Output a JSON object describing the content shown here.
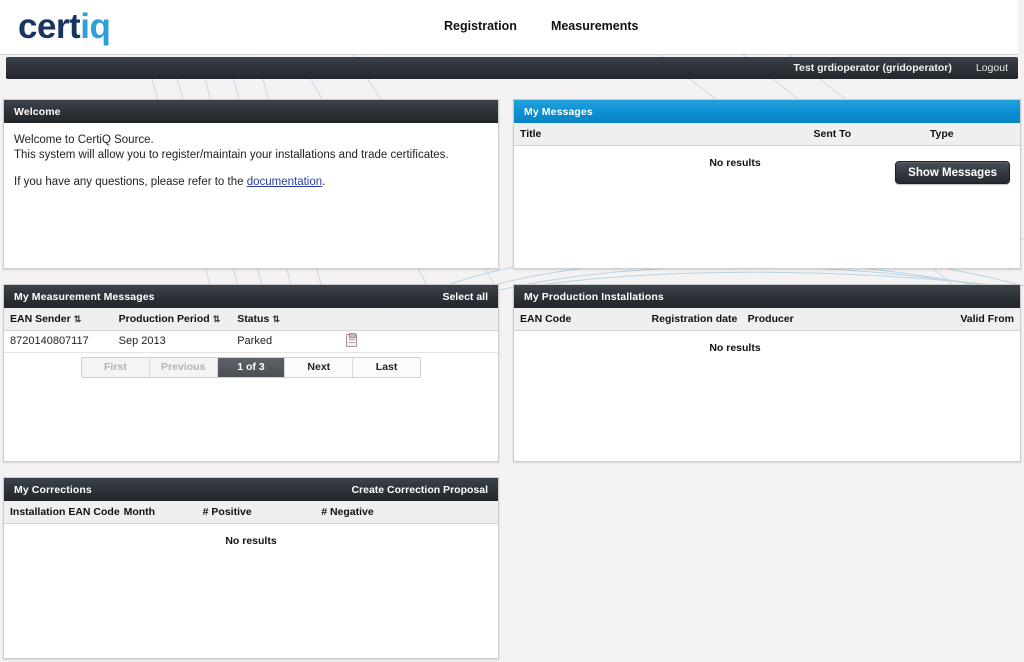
{
  "brand": {
    "logo_dark": "cert",
    "logo_light": "iq",
    "accent_blue": "#0b8fd1",
    "dark_panel": "#2b3036",
    "link_color": "#2b3ea0"
  },
  "nav": {
    "items": [
      {
        "label": "Registration"
      },
      {
        "label": "Measurements"
      }
    ]
  },
  "userbar": {
    "user": "Test grdioperator (gridoperator)",
    "logout": "Logout"
  },
  "welcome": {
    "title": "Welcome",
    "line1": "Welcome to CertiQ Source.",
    "line2": "This system will allow you to register/maintain your installations and trade certificates.",
    "line3_prefix": "If you have any questions, please refer to the ",
    "line3_link": "documentation",
    "line3_suffix": "."
  },
  "my_messages": {
    "title": "My Messages",
    "columns": [
      "Title",
      "Sent To",
      "Type"
    ],
    "empty_text": "No results",
    "button_label": "Show Messages"
  },
  "measurement_messages": {
    "title": "My Measurement Messages",
    "action_label": "Select all",
    "columns": [
      {
        "label": "EAN Sender",
        "sortable": true
      },
      {
        "label": "Production Period",
        "sortable": true
      },
      {
        "label": "Status",
        "sortable": true
      },
      {
        "label": "",
        "sortable": false
      }
    ],
    "sort_glyph": "⇅",
    "rows": [
      {
        "ean_sender": "8720140807117",
        "production_period": "Sep 2013",
        "status": "Parked",
        "icon": "clipboard-icon"
      }
    ],
    "pager": {
      "first": "First",
      "previous": "Previous",
      "current": "1 of 3",
      "next": "Next",
      "last": "Last",
      "first_disabled": true,
      "previous_disabled": true
    }
  },
  "production_installations": {
    "title": "My Production Installations",
    "columns": [
      "EAN Code",
      "Registration date",
      "Producer",
      "Valid From"
    ],
    "empty_text": "No results"
  },
  "corrections": {
    "title": "My Corrections",
    "action_label": "Create Correction Proposal",
    "columns": [
      "Installation EAN Code",
      "Month",
      "# Positive",
      "# Negative"
    ],
    "empty_text": "No results"
  }
}
